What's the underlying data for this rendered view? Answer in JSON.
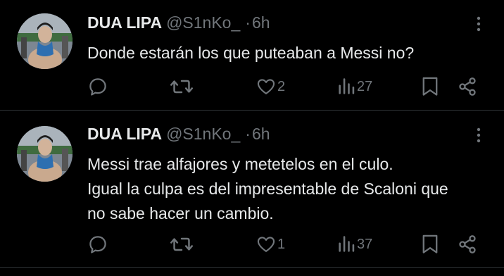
{
  "tweets": [
    {
      "author_name": "DUA LIPA",
      "handle": "@S1nKo_",
      "separator": "·",
      "time": "6h",
      "text_lines": [
        "Donde estarán los que puteaban a Messi no?"
      ],
      "likes": "2",
      "views": "27"
    },
    {
      "author_name": "DUA LIPA",
      "handle": "@S1nKo_",
      "separator": "·",
      "time": "6h",
      "text_lines": [
        "Messi trae alfajores y metetelos en el culo.",
        "Igual la culpa es del impresentable de Scaloni que",
        "no sabe hacer un cambio."
      ],
      "likes": "1",
      "views": "37"
    }
  ],
  "icons": {
    "reply": "reply-icon",
    "retweet": "retweet-icon",
    "like": "heart-icon",
    "views": "views-chart-icon",
    "bookmark": "bookmark-icon",
    "share": "share-icon",
    "more": "more-dots-icon"
  },
  "colors": {
    "background": "#000000",
    "text_primary": "#e7e9ea",
    "text_secondary": "#71767b",
    "divider": "#2f3336"
  }
}
